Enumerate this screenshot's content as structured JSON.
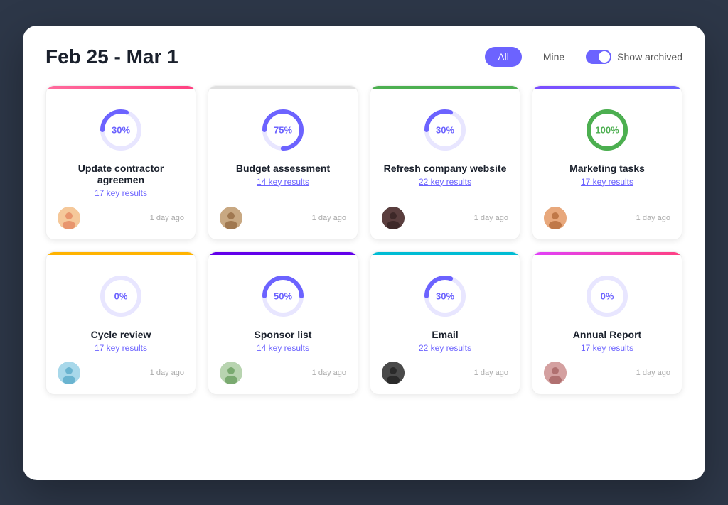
{
  "header": {
    "title": "Feb 25 - Mar 1",
    "filter_all": "All",
    "filter_mine": "Mine",
    "show_archived": "Show archived"
  },
  "cards": [
    {
      "id": "update-contractor",
      "title": "Update contractor agreemen",
      "key_results": "17 key results",
      "time": "1 day ago",
      "progress": 30,
      "color": "pink",
      "avatar": "av1"
    },
    {
      "id": "budget-assessment",
      "title": "Budget assessment",
      "key_results": "14 key results",
      "time": "1 day ago",
      "progress": 75,
      "color": "gray",
      "avatar": "av2"
    },
    {
      "id": "refresh-company-website",
      "title": "Refresh company website",
      "key_results": "22 key results",
      "time": "1 day ago",
      "progress": 30,
      "color": "green",
      "avatar": "av3"
    },
    {
      "id": "marketing-tasks",
      "title": "Marketing tasks",
      "key_results": "17 key results",
      "time": "1 day ago",
      "progress": 100,
      "color": "purple",
      "avatar": "av4"
    },
    {
      "id": "cycle-review",
      "title": "Cycle review",
      "key_results": "17 key results",
      "time": "1 day ago",
      "progress": 0,
      "color": "orange",
      "avatar": "av5"
    },
    {
      "id": "sponsor-list",
      "title": "Sponsor list",
      "key_results": "14 key results",
      "time": "1 day ago",
      "progress": 50,
      "color": "deep-purple",
      "avatar": "av6"
    },
    {
      "id": "email",
      "title": "Email",
      "key_results": "22 key results",
      "time": "1 day ago",
      "progress": 30,
      "color": "cyan",
      "avatar": "av7"
    },
    {
      "id": "annual-report",
      "title": "Annual Report",
      "key_results": "17 key results",
      "time": "1 day ago",
      "progress": 0,
      "color": "magenta",
      "avatar": "av8"
    }
  ]
}
